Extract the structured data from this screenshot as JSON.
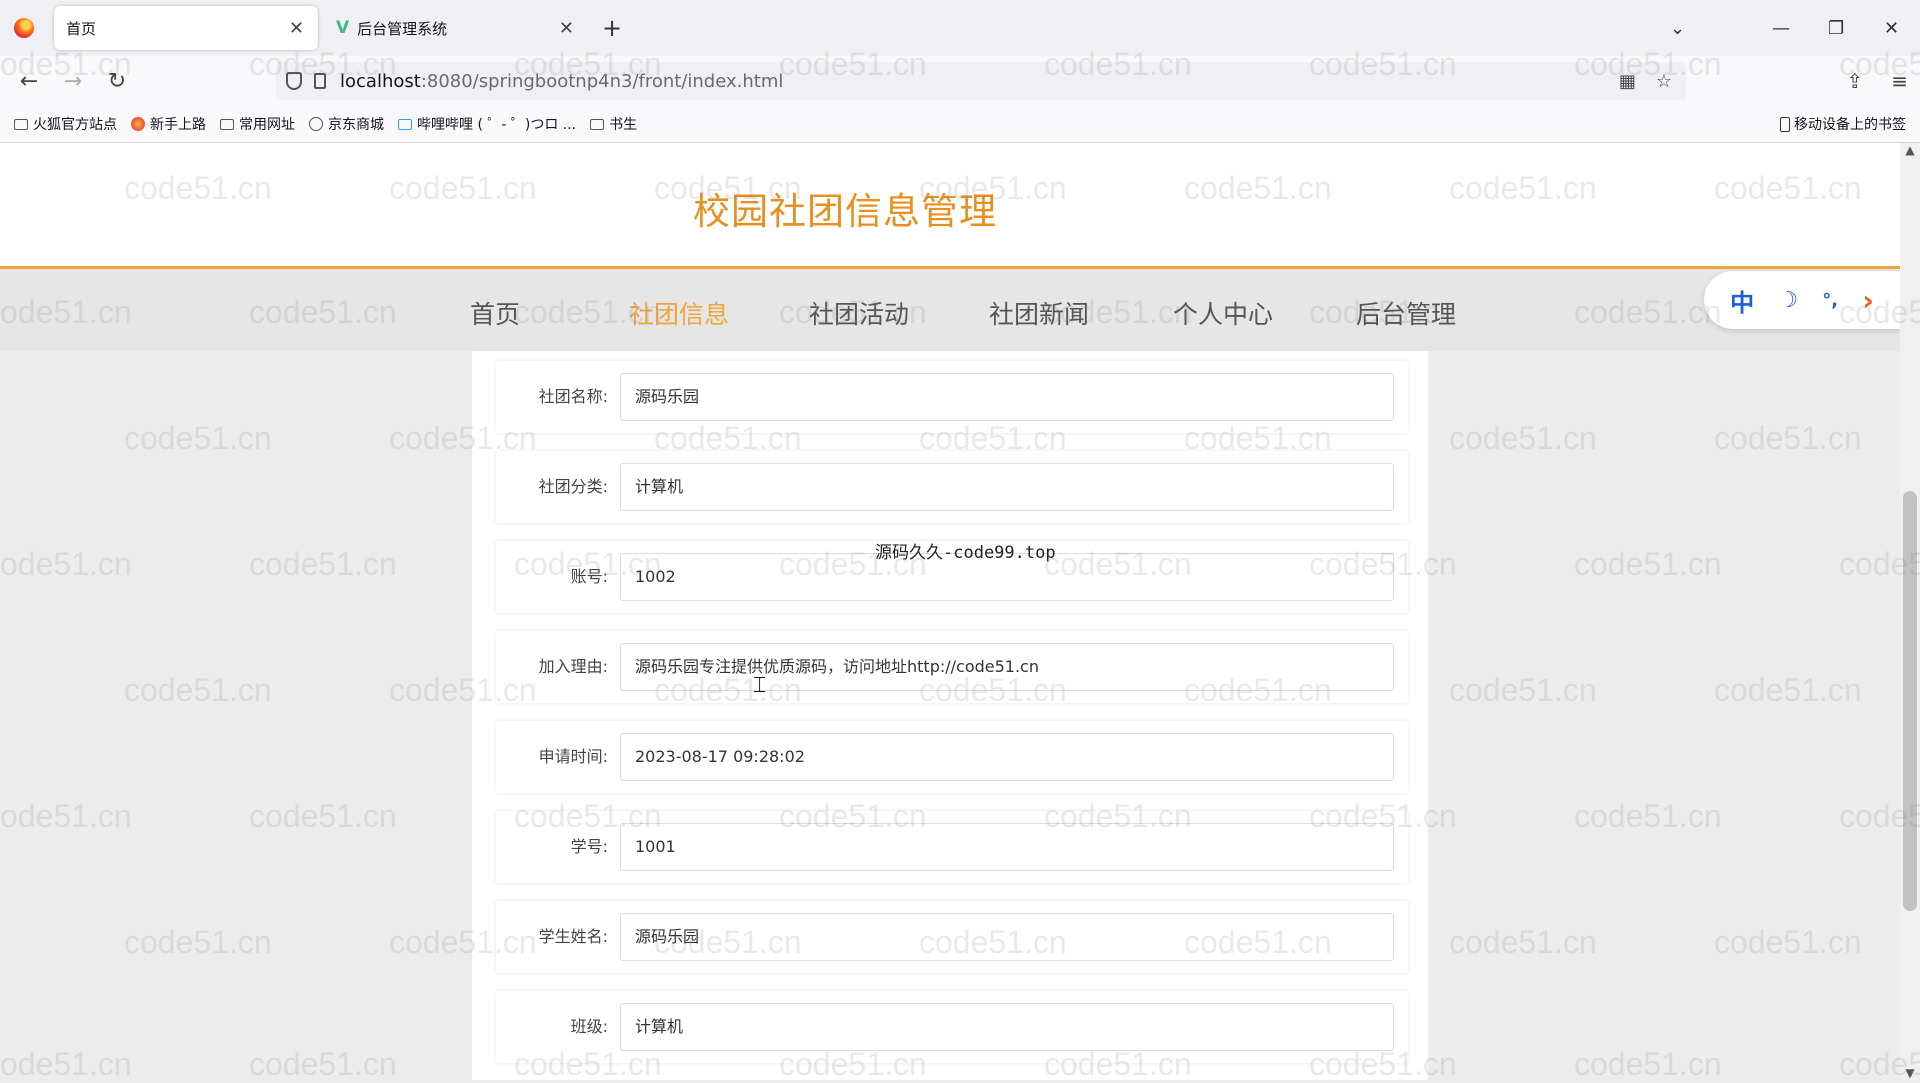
{
  "browser": {
    "tabs": [
      {
        "label": "首页",
        "active": true
      },
      {
        "label": "后台管理系统",
        "active": false
      }
    ],
    "url_host": "localhost",
    "url_path": ":8080/springbootnp4n3/front/index.html",
    "bookmarks": [
      "火狐官方站点",
      "新手上路",
      "常用网址",
      "京东商城",
      "哔哩哔哩 ( ゜- ゜)つロ ...",
      "书生"
    ],
    "mobile_bookmarks": "移动设备上的书签"
  },
  "site": {
    "title": "校园社团信息管理",
    "nav": [
      {
        "label": "首页",
        "active": false
      },
      {
        "label": "社团信息",
        "active": true
      },
      {
        "label": "社团活动",
        "active": false
      },
      {
        "label": "社团新闻",
        "active": false
      },
      {
        "label": "个人中心",
        "active": false
      },
      {
        "label": "后台管理",
        "active": false
      }
    ]
  },
  "ime": {
    "lang": "中",
    "moon": "☽",
    "punct": "°,",
    "arrow": "›"
  },
  "form": {
    "fields": [
      {
        "label": "社团名称:",
        "value": "源码乐园"
      },
      {
        "label": "社团分类:",
        "value": "计算机"
      },
      {
        "label": "账号:",
        "value": "1002"
      },
      {
        "label": "加入理由:",
        "value": "源码乐园专注提供优质源码，访问地址http://code51.cn"
      },
      {
        "label": "申请时间:",
        "value": "2023-08-17 09:28:02"
      },
      {
        "label": "学号:",
        "value": "1001"
      },
      {
        "label": "学生姓名:",
        "value": "源码乐园"
      },
      {
        "label": "班级:",
        "value": "计算机"
      }
    ]
  },
  "overlay_text": "源码久久-code99.top",
  "watermark": "code51.cn",
  "colors": {
    "accent": "#f0a43a",
    "title": "#e8901f"
  }
}
